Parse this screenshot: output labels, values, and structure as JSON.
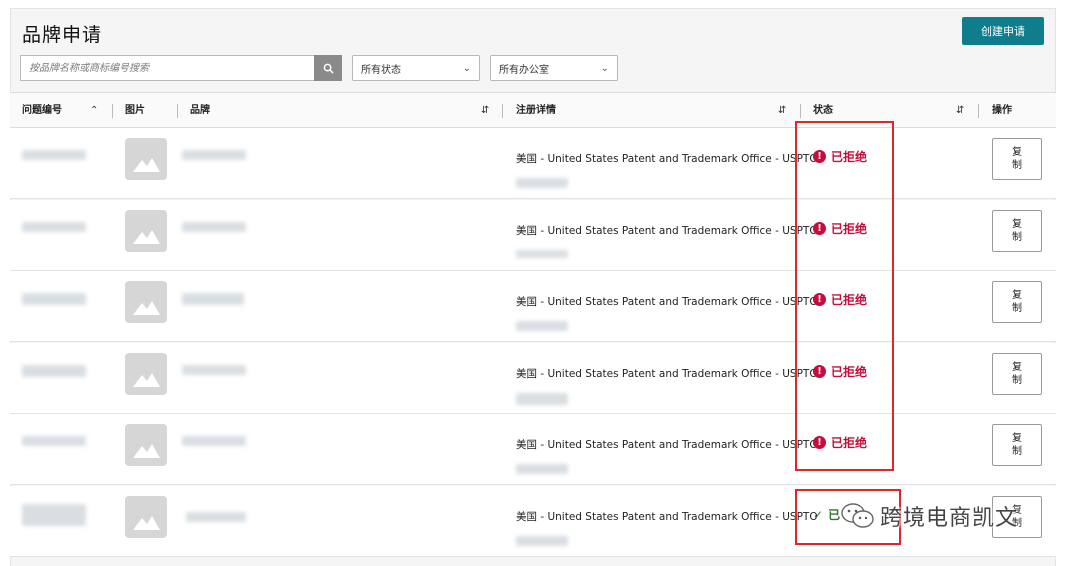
{
  "page": {
    "title": "品牌申请",
    "create_label": "创建申请"
  },
  "filters": {
    "search_placeholder": "按品牌名称或商标编号搜索",
    "status_select": "所有状态",
    "office_select": "所有办公室"
  },
  "table": {
    "headers": {
      "issue_no": "问题编号",
      "image": "图片",
      "brand": "品牌",
      "registration": "注册详情",
      "status": "状态",
      "action": "操作"
    },
    "rows": [
      {
        "registration": "美国 - United States Patent and Trademark Office - USPTO",
        "status": "已拒绝",
        "status_kind": "rejected",
        "action": "复制"
      },
      {
        "registration": "美国 - United States Patent and Trademark Office - USPTO",
        "status": "已拒绝",
        "status_kind": "rejected",
        "action": "复制"
      },
      {
        "registration": "美国 - United States Patent and Trademark Office - USPTO",
        "status": "已拒绝",
        "status_kind": "rejected",
        "action": "复制"
      },
      {
        "registration": "美国 - United States Patent and Trademark Office - USPTO",
        "status": "已拒绝",
        "status_kind": "rejected",
        "action": "复制"
      },
      {
        "registration": "美国 - United States Patent and Trademark Office - USPTO",
        "status": "已拒绝",
        "status_kind": "rejected",
        "action": "复制"
      },
      {
        "registration": "美国 - United States Patent and Trademark Office - USPTO",
        "status": "已",
        "status_kind": "approved",
        "action": "复制"
      }
    ]
  },
  "watermark": "跨境电商凯文",
  "colors": {
    "accent": "#0f7d8c",
    "rejected": "#c40f3c",
    "approved": "#2d7a2d",
    "highlight": "#e0252c"
  }
}
